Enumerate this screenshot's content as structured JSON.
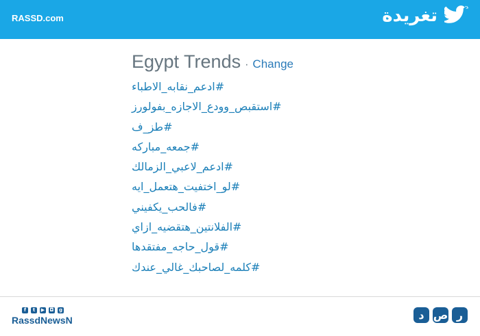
{
  "header": {
    "site": "RASSD.com",
    "brand": "تغريدة",
    "bird_icon": "twitter-bird-icon",
    "background": "#1aa7e6"
  },
  "trends_card": {
    "title": "Egypt Trends",
    "separator": "·",
    "change_label": "Change",
    "items": [
      "#ادعم_نقابه_الاطباء",
      "#استقبص_وودع_الاجازه_بفولورز",
      "#طز_ف",
      "#جمعه_مباركه",
      "#ادعم_لاعبي_الزمالك",
      "#لو_اختفيت_هتعمل_ايه",
      "#فالحب_يكفيني",
      "#الفلانتين_هتقضيه_ازاي",
      "#قول_حاجه_مفتقدها",
      "#كلمه_لصاحبك_غالي_عندك"
    ],
    "link_color": "#1b7fb8"
  },
  "footer": {
    "social_icons": [
      "facebook-icon",
      "twitter-icon",
      "youtube-icon",
      "instagram-icon",
      "googleplus-icon"
    ],
    "social_glyphs": [
      "f",
      "t",
      "▶",
      "◘",
      "g"
    ],
    "handle": "RassdNewsN",
    "logo_letters": [
      "د",
      "ص",
      "ر"
    ]
  }
}
